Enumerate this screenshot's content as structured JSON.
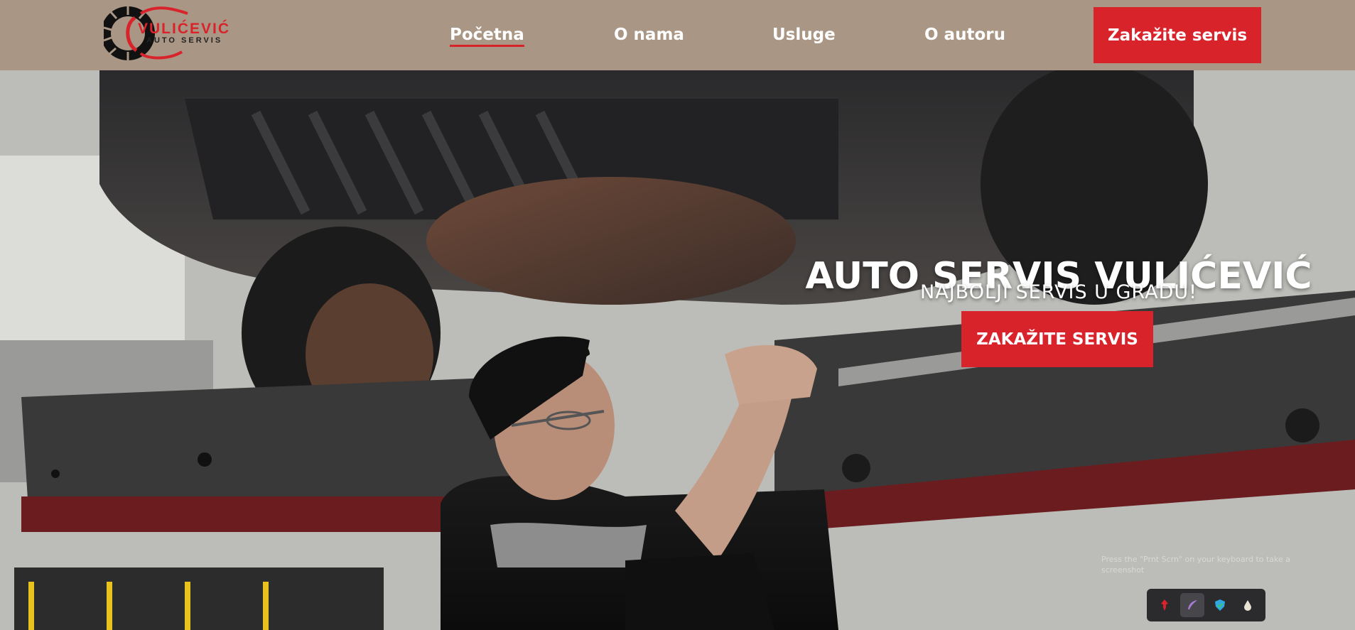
{
  "header": {
    "logo": {
      "title": "VULIĆEVIĆ",
      "subtitle": "AUTO SERVIS"
    },
    "nav": [
      {
        "label": "Početna",
        "active": true
      },
      {
        "label": "O nama",
        "active": false
      },
      {
        "label": "Usluge",
        "active": false
      },
      {
        "label": "O autoru",
        "active": false
      }
    ],
    "cta_label": "Zakažite servis"
  },
  "hero": {
    "title": "AUTO SERVIS VULIĆEVIĆ",
    "subtitle": "NAJBOLJI SERVIS U GRADU!",
    "cta_label": "ZAKAŽITE SERVIS"
  },
  "screenshot_overlay": {
    "hint": "Press the \"Prnt Scrn\" on your keyboard to take a screenshot",
    "tools": [
      {
        "icon": "pin-icon",
        "color": "#d9232b"
      },
      {
        "icon": "feather-icon",
        "color": "#a77bd6"
      },
      {
        "icon": "shield-check-icon",
        "color": "#2fa7e0"
      },
      {
        "icon": "drop-icon",
        "color": "#e8e2d2"
      }
    ]
  },
  "colors": {
    "header_bg": "#a99684",
    "accent": "#d9232b",
    "text_light": "#ffffff"
  }
}
